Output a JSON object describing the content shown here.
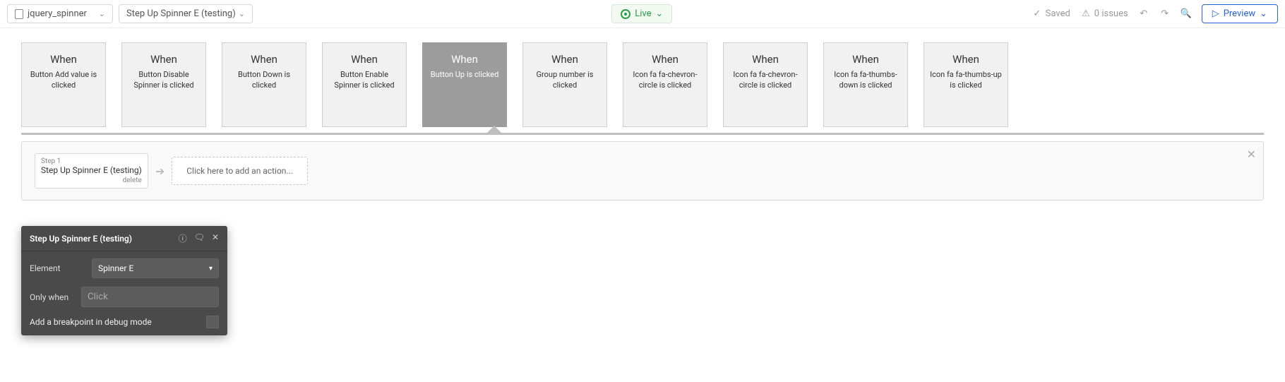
{
  "toolbar": {
    "page_dropdown": "jquery_spinner",
    "element_dropdown": "Step Up Spinner E (testing)",
    "live": "Live",
    "saved": "Saved",
    "issues_count": "0 issues",
    "preview": "Preview"
  },
  "events": [
    {
      "when": "When",
      "desc": "Button Add value is clicked",
      "selected": false
    },
    {
      "when": "When",
      "desc": "Button Disable Spinner is clicked",
      "selected": false
    },
    {
      "when": "When",
      "desc": "Button Down is clicked",
      "selected": false
    },
    {
      "when": "When",
      "desc": "Button Enable Spinner is clicked",
      "selected": false
    },
    {
      "when": "When",
      "desc": "Button Up is clicked",
      "selected": true
    },
    {
      "when": "When",
      "desc": "Group number is clicked",
      "selected": false
    },
    {
      "when": "When",
      "desc": "Icon fa fa-chevron-circle is clicked",
      "selected": false
    },
    {
      "when": "When",
      "desc": "Icon fa fa-chevron-circle is clicked",
      "selected": false
    },
    {
      "when": "When",
      "desc": "Icon fa fa-thumbs-down is clicked",
      "selected": false
    },
    {
      "when": "When",
      "desc": "Icon fa fa-thumbs-up is clicked",
      "selected": false
    }
  ],
  "flow": {
    "step_label": "Step 1",
    "step_title": "Step Up Spinner E (testing)",
    "delete": "delete",
    "add_action": "Click here to add an action..."
  },
  "panel": {
    "title": "Step Up Spinner E (testing)",
    "element_label": "Element",
    "element_value": "Spinner E",
    "only_when_label": "Only when",
    "only_when_placeholder": "Click",
    "breakpoint_label": "Add a breakpoint in debug mode"
  }
}
